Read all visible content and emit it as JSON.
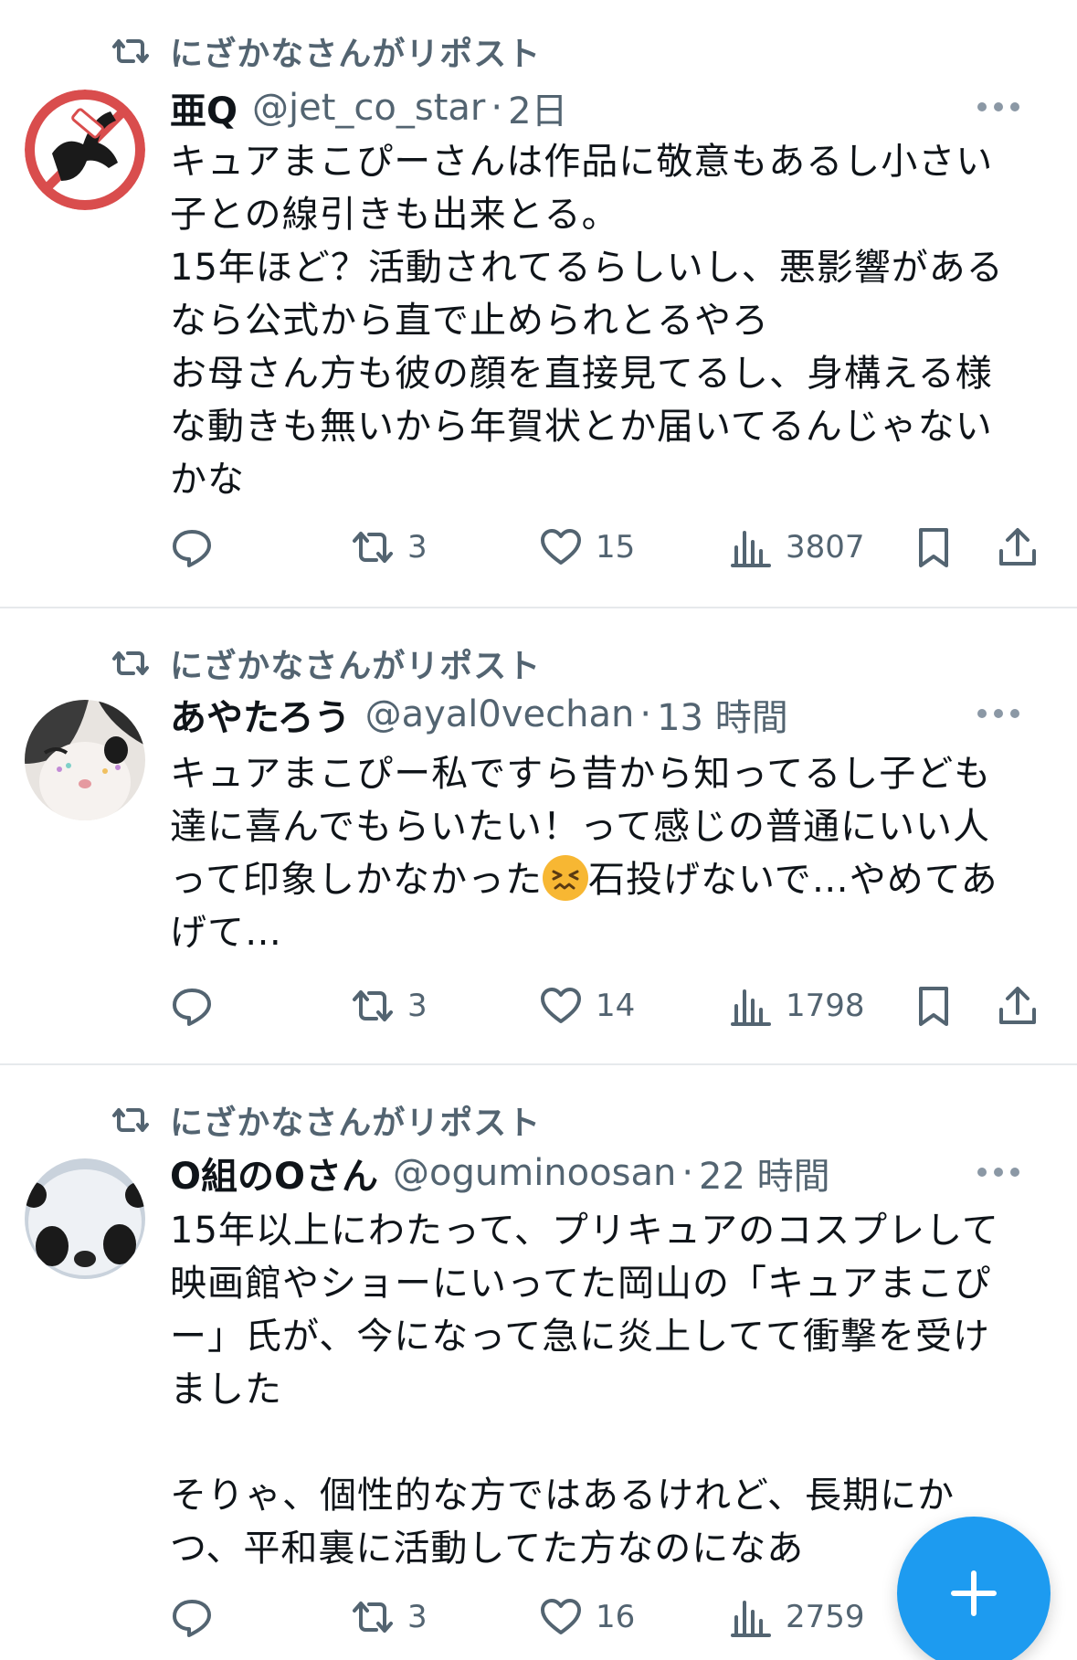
{
  "tweets": [
    {
      "repost_label": "にざかなさんがリポスト",
      "name": "亜Q",
      "handle": "@jet_co_star",
      "dot": "·",
      "time": "2日",
      "text": "キュアまこぴーさんは作品に敬意もあるし小さい\n子との線引きも出来とる。\n15年ほど？活動されてるらしいし、悪影響がある\nなら公式から直で止められとるやろ\nお母さん方も彼の顔を直接見てるし、身構える様\nな動きも無いから年賀状とか届いてるんじゃない\nかな",
      "replies": "",
      "reposts": "3",
      "likes": "15",
      "views": "3807"
    },
    {
      "repost_label": "にざかなさんがリポスト",
      "name": "あやたろう",
      "handle": "@ayal0vechan",
      "dot": "·",
      "time": "13 時間",
      "text_before_emoji": "キュアまこぴー私ですら昔から知ってるし子ども\n達に喜んでもらいたい！って感じの普通にいい人\nって印象しかなかった",
      "text_after_emoji": "石投げないで…やめてあ\nげて…",
      "emoji_name": "confounded-face-emoji",
      "replies": "",
      "reposts": "3",
      "likes": "14",
      "views": "1798"
    },
    {
      "repost_label": "にざかなさんがリポスト",
      "name": "O組のOさん",
      "handle": "@oguminoosan",
      "dot": "·",
      "time": "22 時間",
      "text": "15年以上にわたって、プリキュアのコスプレして\n映画館やショーにいってた岡山の「キュアまこぴ\nー」氏が、今になって急に炎上してて衝撃を受け\nました\n\nそりゃ、個性的な方ではあるけれど、長期にか\nつ、平和裏に活動してた方なのになあ",
      "replies": "",
      "reposts": "3",
      "likes": "16",
      "views": "2759"
    }
  ],
  "icons": {
    "repost": "repost-icon",
    "reply": "reply-icon",
    "like": "heart-icon",
    "views": "views-chart-icon",
    "bookmark": "bookmark-icon",
    "share": "share-icon",
    "more": "more-dots-icon",
    "compose": "plus-icon"
  },
  "colors": {
    "text": "#0f1419",
    "muted": "#536471",
    "accent": "#1d9bf0",
    "divider": "#e6e9ec"
  }
}
